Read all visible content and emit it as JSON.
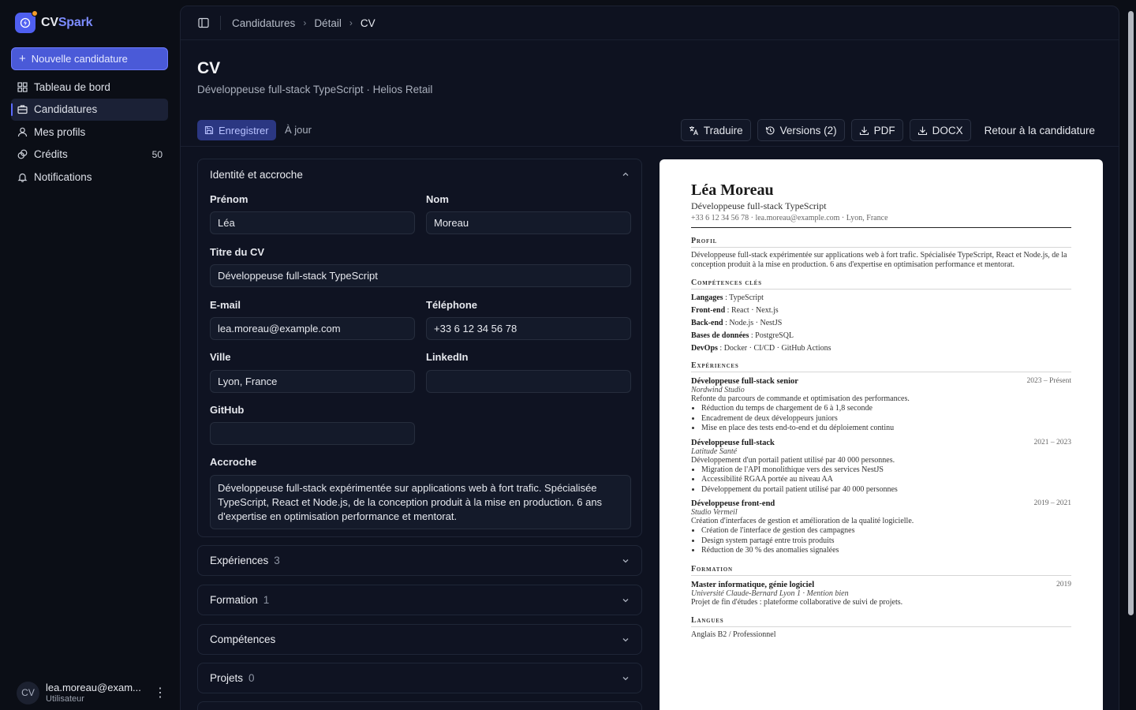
{
  "app": {
    "brand_prefix": "CV",
    "brand_suffix": "Spark"
  },
  "sidebar": {
    "new_button": "Nouvelle candidature",
    "items": [
      {
        "label": "Tableau de bord",
        "icon": "dashboard-icon"
      },
      {
        "label": "Candidatures",
        "icon": "briefcase-icon",
        "active": true
      },
      {
        "label": "Mes profils",
        "icon": "user-icon"
      },
      {
        "label": "Crédits",
        "icon": "coins-icon",
        "count": "50"
      },
      {
        "label": "Notifications",
        "icon": "bell-icon"
      }
    ],
    "user": {
      "initials": "CV",
      "email": "lea.moreau@exam...",
      "role": "Utilisateur"
    }
  },
  "breadcrumb": [
    "Candidatures",
    "Détail",
    "CV"
  ],
  "page": {
    "title": "CV",
    "subtitle": "Développeuse full-stack TypeScript · Helios Retail"
  },
  "toolbar": {
    "save": "Enregistrer",
    "status": "À jour",
    "translate": "Traduire",
    "versions": "Versions (2)",
    "pdf": "PDF",
    "docx": "DOCX",
    "back": "Retour à la candidature"
  },
  "form": {
    "section_title": "Identité et accroche",
    "fields": {
      "first_name": {
        "label": "Prénom",
        "value": "Léa"
      },
      "last_name": {
        "label": "Nom",
        "value": "Moreau"
      },
      "cv_title": {
        "label": "Titre du CV",
        "value": "Développeuse full-stack TypeScript"
      },
      "email": {
        "label": "E-mail",
        "value": "lea.moreau@example.com"
      },
      "phone": {
        "label": "Téléphone",
        "value": "+33 6 12 34 56 78"
      },
      "city": {
        "label": "Ville",
        "value": "Lyon, France"
      },
      "linkedin": {
        "label": "LinkedIn",
        "value": ""
      },
      "github": {
        "label": "GitHub",
        "value": ""
      },
      "hook": {
        "label": "Accroche",
        "value": "Développeuse full-stack expérimentée sur applications web à fort trafic. Spécialisée TypeScript, React et Node.js, de la conception produit à la mise en production. 6 ans d'expertise en optimisation performance et mentorat."
      }
    },
    "sections": [
      {
        "label": "Expériences",
        "count": "3"
      },
      {
        "label": "Formation",
        "count": "1"
      },
      {
        "label": "Compétences",
        "count": ""
      },
      {
        "label": "Projets",
        "count": "0"
      }
    ]
  },
  "cv": {
    "name": "Léa Moreau",
    "title": "Développeuse full-stack TypeScript",
    "contact": "+33 6 12 34 56 78 · lea.moreau@example.com · Lyon, France",
    "profile_heading": "Profil",
    "profile_text": "Développeuse full-stack expérimentée sur applications web à fort trafic. Spécialisée TypeScript, React et Node.js, de la conception produit à la mise en production. 6 ans d'expertise en optimisation performance et mentorat.",
    "skills_heading": "Compétences clés",
    "skills": [
      {
        "label": "Langages",
        "value": "TypeScript"
      },
      {
        "label": "Front-end",
        "value": "React · Next.js"
      },
      {
        "label": "Back-end",
        "value": "Node.js · NestJS"
      },
      {
        "label": "Bases de données",
        "value": "PostgreSQL"
      },
      {
        "label": "DevOps",
        "value": "Docker · CI/CD · GitHub Actions"
      }
    ],
    "experience_heading": "Expériences",
    "experiences": [
      {
        "role": "Développeuse full-stack senior",
        "dates": "2023 – Présent",
        "company": "Nordwind Studio",
        "summary": "Refonte du parcours de commande et optimisation des performances.",
        "bullets": [
          "Réduction du temps de chargement de 6 à 1,8 seconde",
          "Encadrement de deux développeurs juniors",
          "Mise en place des tests end-to-end et du déploiement continu"
        ]
      },
      {
        "role": "Développeuse full-stack",
        "dates": "2021 – 2023",
        "company": "Latitude Santé",
        "summary": "Développement d'un portail patient utilisé par 40 000 personnes.",
        "bullets": [
          "Migration de l'API monolithique vers des services NestJS",
          "Accessibilité RGAA portée au niveau AA",
          "Développement du portail patient utilisé par 40 000 personnes"
        ]
      },
      {
        "role": "Développeuse front-end",
        "dates": "2019 – 2021",
        "company": "Studio Vermeil",
        "summary": "Création d'interfaces de gestion et amélioration de la qualité logicielle.",
        "bullets": [
          "Création de l'interface de gestion des campagnes",
          "Design system partagé entre trois produits",
          "Réduction de 30 % des anomalies signalées"
        ]
      }
    ],
    "education_heading": "Formation",
    "education": {
      "degree": "Master informatique, génie logiciel",
      "year": "2019",
      "school": "Université Claude-Bernard Lyon 1 · Mention bien",
      "summary": "Projet de fin d'études : plateforme collaborative de suivi de projets."
    },
    "languages_heading": "Langues",
    "languages": "Anglais B2 / Professionnel"
  }
}
